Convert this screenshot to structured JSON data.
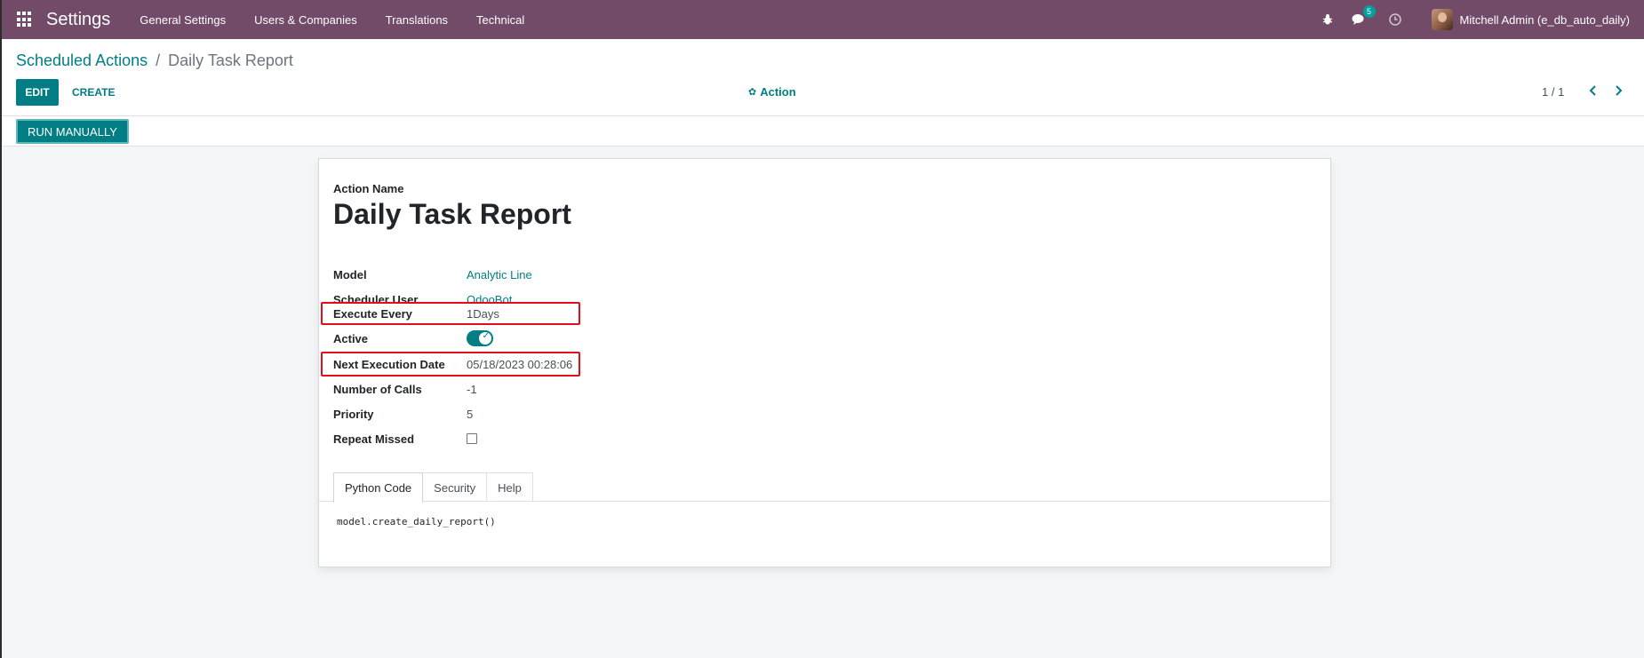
{
  "navbar": {
    "app_title": "Settings",
    "menu": [
      "General Settings",
      "Users & Companies",
      "Translations",
      "Technical"
    ],
    "icons": [
      "bug-icon",
      "chat-icon",
      "clock-icon"
    ],
    "messages_badge": "5",
    "user_name": "Mitchell Admin (e_db_auto_daily)",
    "bg_color": "#714b67"
  },
  "control_panel": {
    "breadcrumb_parent": "Scheduled Actions",
    "breadcrumb_sep": "/",
    "breadcrumb_current": "Daily Task Report",
    "edit_label": "EDIT",
    "create_label": "CREATE",
    "action_label": "Action",
    "pager": "1 / 1"
  },
  "statusbar": {
    "run_label": "RUN MANUALLY"
  },
  "form": {
    "name_label": "Action Name",
    "name": "Daily Task Report",
    "fields": {
      "model": {
        "label": "Model",
        "value": "Analytic Line"
      },
      "user": {
        "label": "Scheduler User",
        "value": "OdooBot"
      },
      "interval": {
        "label": "Execute Every",
        "value": "1Days"
      },
      "active": {
        "label": "Active",
        "value": true
      },
      "nextcall": {
        "label": "Next Execution Date",
        "value": "05/18/2023 00:28:06"
      },
      "numbercall": {
        "label": "Number of Calls",
        "value": "-1"
      },
      "priority": {
        "label": "Priority",
        "value": "5"
      },
      "doall": {
        "label": "Repeat Missed",
        "value": false
      }
    },
    "tabs": [
      "Python Code",
      "Security",
      "Help"
    ],
    "active_tab": "Python Code",
    "code": "model.create_daily_report()"
  },
  "colors": {
    "primary": "#017e84",
    "highlight": "#e10f1a"
  }
}
